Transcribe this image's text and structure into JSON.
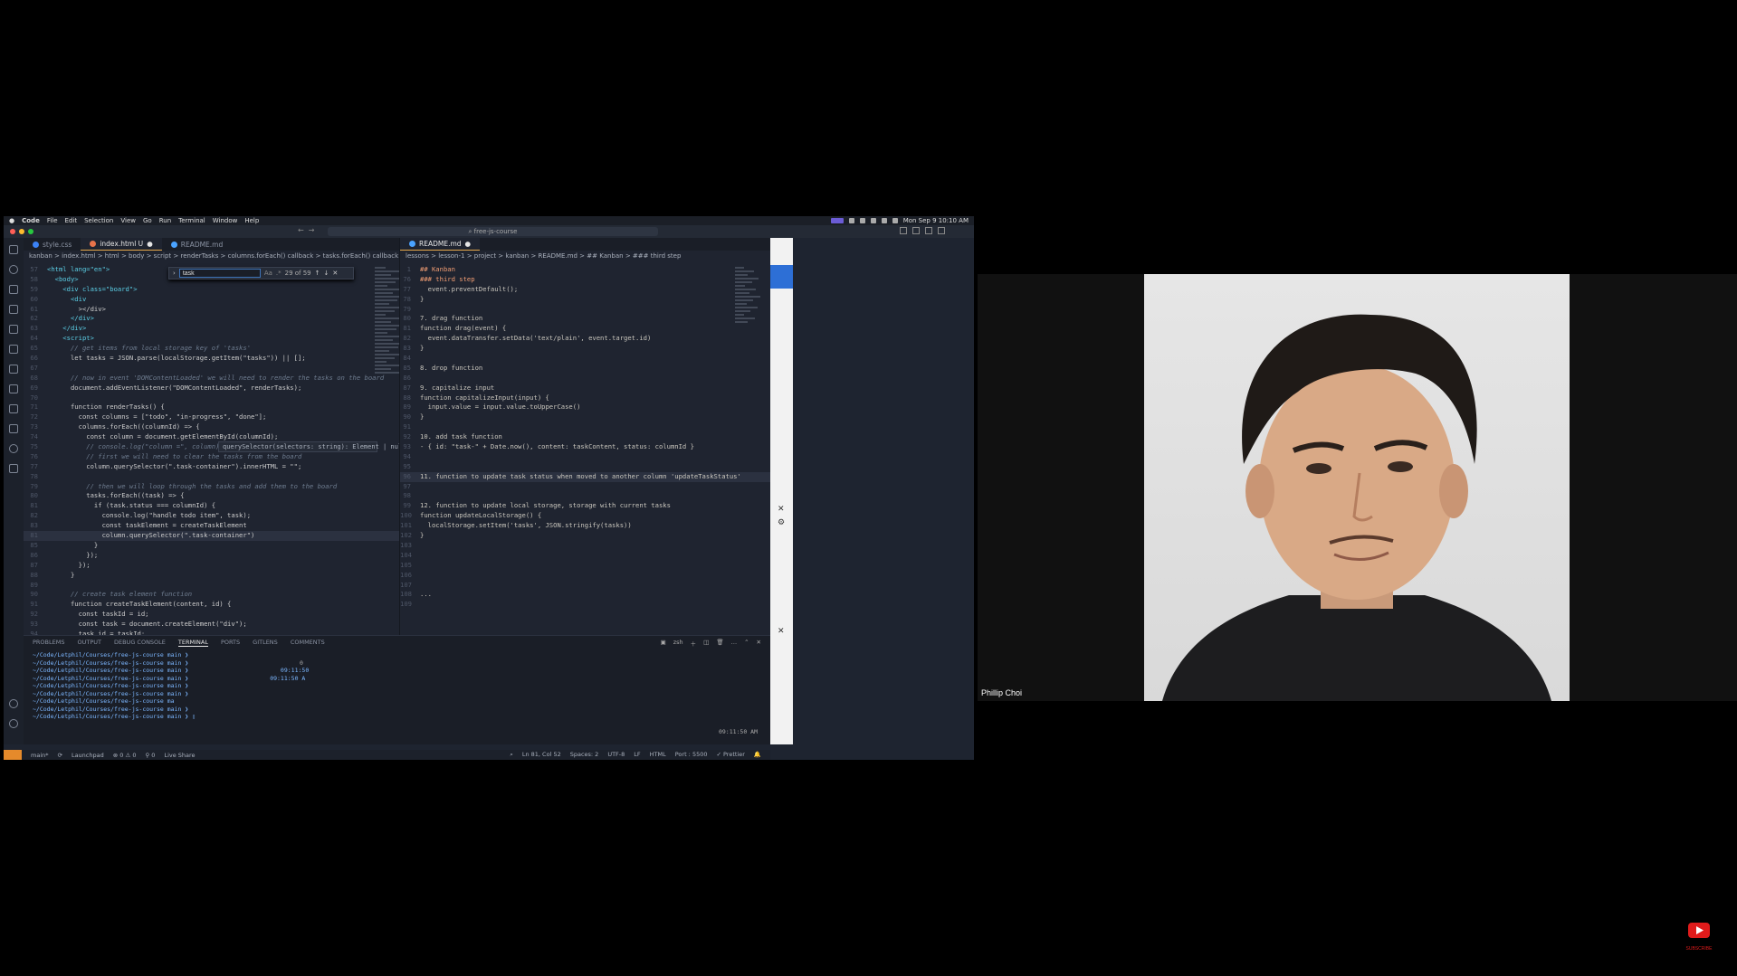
{
  "menubar": {
    "app": "Code",
    "items": [
      "File",
      "Edit",
      "Selection",
      "View",
      "Go",
      "Run",
      "Terminal",
      "Window",
      "Help"
    ],
    "clock": "Mon Sep 9  10:10 AM"
  },
  "titlebar": {
    "search": "free-js-course"
  },
  "left_editor": {
    "tabs": [
      {
        "label": "style.css"
      },
      {
        "label": "index.html U"
      },
      {
        "label": "README.md"
      }
    ],
    "breadcrumb": "kanban  >  index.html  >  html  >  body  >  script  >  renderTasks  >  columns.forEach() callback  >  tasks.forEach() callback",
    "find": {
      "query": "task",
      "result": "29 of 59"
    },
    "tooltip": "querySelector(selectors: string): Element | null",
    "lines": [
      {
        "n": "57",
        "text": "<html lang=\"en\">"
      },
      {
        "n": "58",
        "text": "  <body>"
      },
      {
        "n": "59",
        "text": "    <div class=\"board\">"
      },
      {
        "n": "60",
        "text": "      <div"
      },
      {
        "n": "61",
        "text": "        ></div>"
      },
      {
        "n": "62",
        "text": "      </div>"
      },
      {
        "n": "63",
        "text": "    </div>"
      },
      {
        "n": "64",
        "text": "    <script>"
      },
      {
        "n": "65",
        "text": "      // get items from local storage key of 'tasks'"
      },
      {
        "n": "66",
        "text": "      let tasks = JSON.parse(localStorage.getItem(\"tasks\")) || [];"
      },
      {
        "n": "67",
        "text": ""
      },
      {
        "n": "68",
        "text": "      // now in event 'DOMContentLoaded' we will need to render the tasks on the board"
      },
      {
        "n": "69",
        "text": "      document.addEventListener(\"DOMContentLoaded\", renderTasks);"
      },
      {
        "n": "70",
        "text": ""
      },
      {
        "n": "71",
        "text": "      function renderTasks() {"
      },
      {
        "n": "72",
        "text": "        const columns = [\"todo\", \"in-progress\", \"done\"];"
      },
      {
        "n": "73",
        "text": "        columns.forEach((columnId) => {"
      },
      {
        "n": "74",
        "text": "          const column = document.getElementById(columnId);"
      },
      {
        "n": "75",
        "text": "          // console.log(\"column =\", column);"
      },
      {
        "n": "76",
        "text": "          // first we will need to clear the tasks from the board"
      },
      {
        "n": "77",
        "text": "          column.querySelector(\".task-container\").innerHTML = \"\";"
      },
      {
        "n": "78",
        "text": ""
      },
      {
        "n": "79",
        "text": "          // then we will loop through the tasks and add them to the board"
      },
      {
        "n": "80",
        "text": "          tasks.forEach((task) => {"
      },
      {
        "n": "81",
        "text": "            if (task.status === columnId) {"
      },
      {
        "n": "82",
        "text": "              console.log(\"handle todo item\", task);"
      },
      {
        "n": "83",
        "text": "              const taskElement = createTaskElement"
      },
      {
        "n": "81",
        "text": "              column.querySelector(\".task-container\")"
      },
      {
        "n": "85",
        "text": "            }"
      },
      {
        "n": "86",
        "text": "          });"
      },
      {
        "n": "87",
        "text": "        });"
      },
      {
        "n": "88",
        "text": "      }"
      },
      {
        "n": "89",
        "text": ""
      },
      {
        "n": "90",
        "text": "      // create task element function"
      },
      {
        "n": "91",
        "text": "      function createTaskElement(content, id) {"
      },
      {
        "n": "92",
        "text": "        const taskId = id;"
      },
      {
        "n": "93",
        "text": "        const task = document.createElement(\"div\");"
      },
      {
        "n": "94",
        "text": "        task.id = taskId;"
      }
    ]
  },
  "right_editor": {
    "tabs": [
      {
        "label": "README.md"
      }
    ],
    "breadcrumb": "lessons  >  lesson-1  >  project  >  kanban  >  README.md  >  ## Kanban  >  ### third step",
    "lines": [
      {
        "n": "1",
        "text": "## Kanban"
      },
      {
        "n": "76",
        "text": "### third step"
      },
      {
        "n": "77",
        "text": "  event.preventDefault();"
      },
      {
        "n": "78",
        "text": "}"
      },
      {
        "n": "79",
        "text": ""
      },
      {
        "n": "80",
        "text": "7. drag function"
      },
      {
        "n": "81",
        "text": "function drag(event) {"
      },
      {
        "n": "82",
        "text": "  event.dataTransfer.setData('text/plain', event.target.id)"
      },
      {
        "n": "83",
        "text": "}"
      },
      {
        "n": "84",
        "text": ""
      },
      {
        "n": "85",
        "text": "8. drop function"
      },
      {
        "n": "86",
        "text": ""
      },
      {
        "n": "87",
        "text": "9. capitalize input"
      },
      {
        "n": "88",
        "text": "function capitalizeInput(input) {"
      },
      {
        "n": "89",
        "text": "  input.value = input.value.toUpperCase()"
      },
      {
        "n": "90",
        "text": "}"
      },
      {
        "n": "91",
        "text": ""
      },
      {
        "n": "92",
        "text": "10. add task function"
      },
      {
        "n": "93",
        "text": "- { id: \"task-\" + Date.now(), content: taskContent, status: columnId }"
      },
      {
        "n": "94",
        "text": ""
      },
      {
        "n": "95",
        "text": ""
      },
      {
        "n": "96",
        "text": "11. function to update task status when moved to another column 'updateTaskStatus'"
      },
      {
        "n": "97",
        "text": ""
      },
      {
        "n": "98",
        "text": ""
      },
      {
        "n": "99",
        "text": "12. function to update local storage, storage with current tasks"
      },
      {
        "n": "100",
        "text": "function updateLocalStorage() {"
      },
      {
        "n": "101",
        "text": "  localStorage.setItem('tasks', JSON.stringify(tasks))"
      },
      {
        "n": "102",
        "text": "}"
      },
      {
        "n": "103",
        "text": ""
      },
      {
        "n": "104",
        "text": ""
      },
      {
        "n": "105",
        "text": ""
      },
      {
        "n": "106",
        "text": ""
      },
      {
        "n": "107",
        "text": ""
      },
      {
        "n": "108",
        "text": "..."
      },
      {
        "n": "109",
        "text": ""
      }
    ]
  },
  "panel": {
    "tabs": [
      "PROBLEMS",
      "OUTPUT",
      "DEBUG CONSOLE",
      "TERMINAL",
      "PORTS",
      "GITLENS",
      "COMMENTS"
    ],
    "active_tab": "TERMINAL",
    "shell": "zsh",
    "terminal_lines": [
      "~/Code/Letphil/Courses/free-js-course main ❯",
      "~/Code/Letphil/Courses/free-js-course main ❯",
      "~/Code/Letphil/Courses/free-js-course main ❯                          09:11:50",
      "~/Code/Letphil/Courses/free-js-course main ❯                       09:11:50 A",
      "~/Code/Letphil/Courses/free-js-course main ❯",
      "~/Code/Letphil/Courses/free-js-course main ❯",
      "~/Code/Letphil/Courses/free-js-course ma",
      "~/Code/Letphil/Courses/free-js-course main ❯",
      "~/Code/Letphil/Courses/free-js-course main ❯ ▯"
    ],
    "right_time": "09:11:50 AM",
    "right_code": "0"
  },
  "statusbar": {
    "branch": "main*",
    "launchpad": "Launchpad",
    "problems": "⊗ 0 ⚠ 0",
    "ports": "⚲ 0",
    "liveshare": "Live Share",
    "position": "Ln 81, Col 52",
    "spaces": "Spaces: 2",
    "encoding": "UTF-8",
    "eol": "LF",
    "language": "HTML",
    "port": "Port : 5500",
    "prettier": "✓ Prettier"
  },
  "webcam": {
    "name": "Phillip Choi"
  },
  "youtube": {
    "label": "SUBSCRIBE"
  }
}
